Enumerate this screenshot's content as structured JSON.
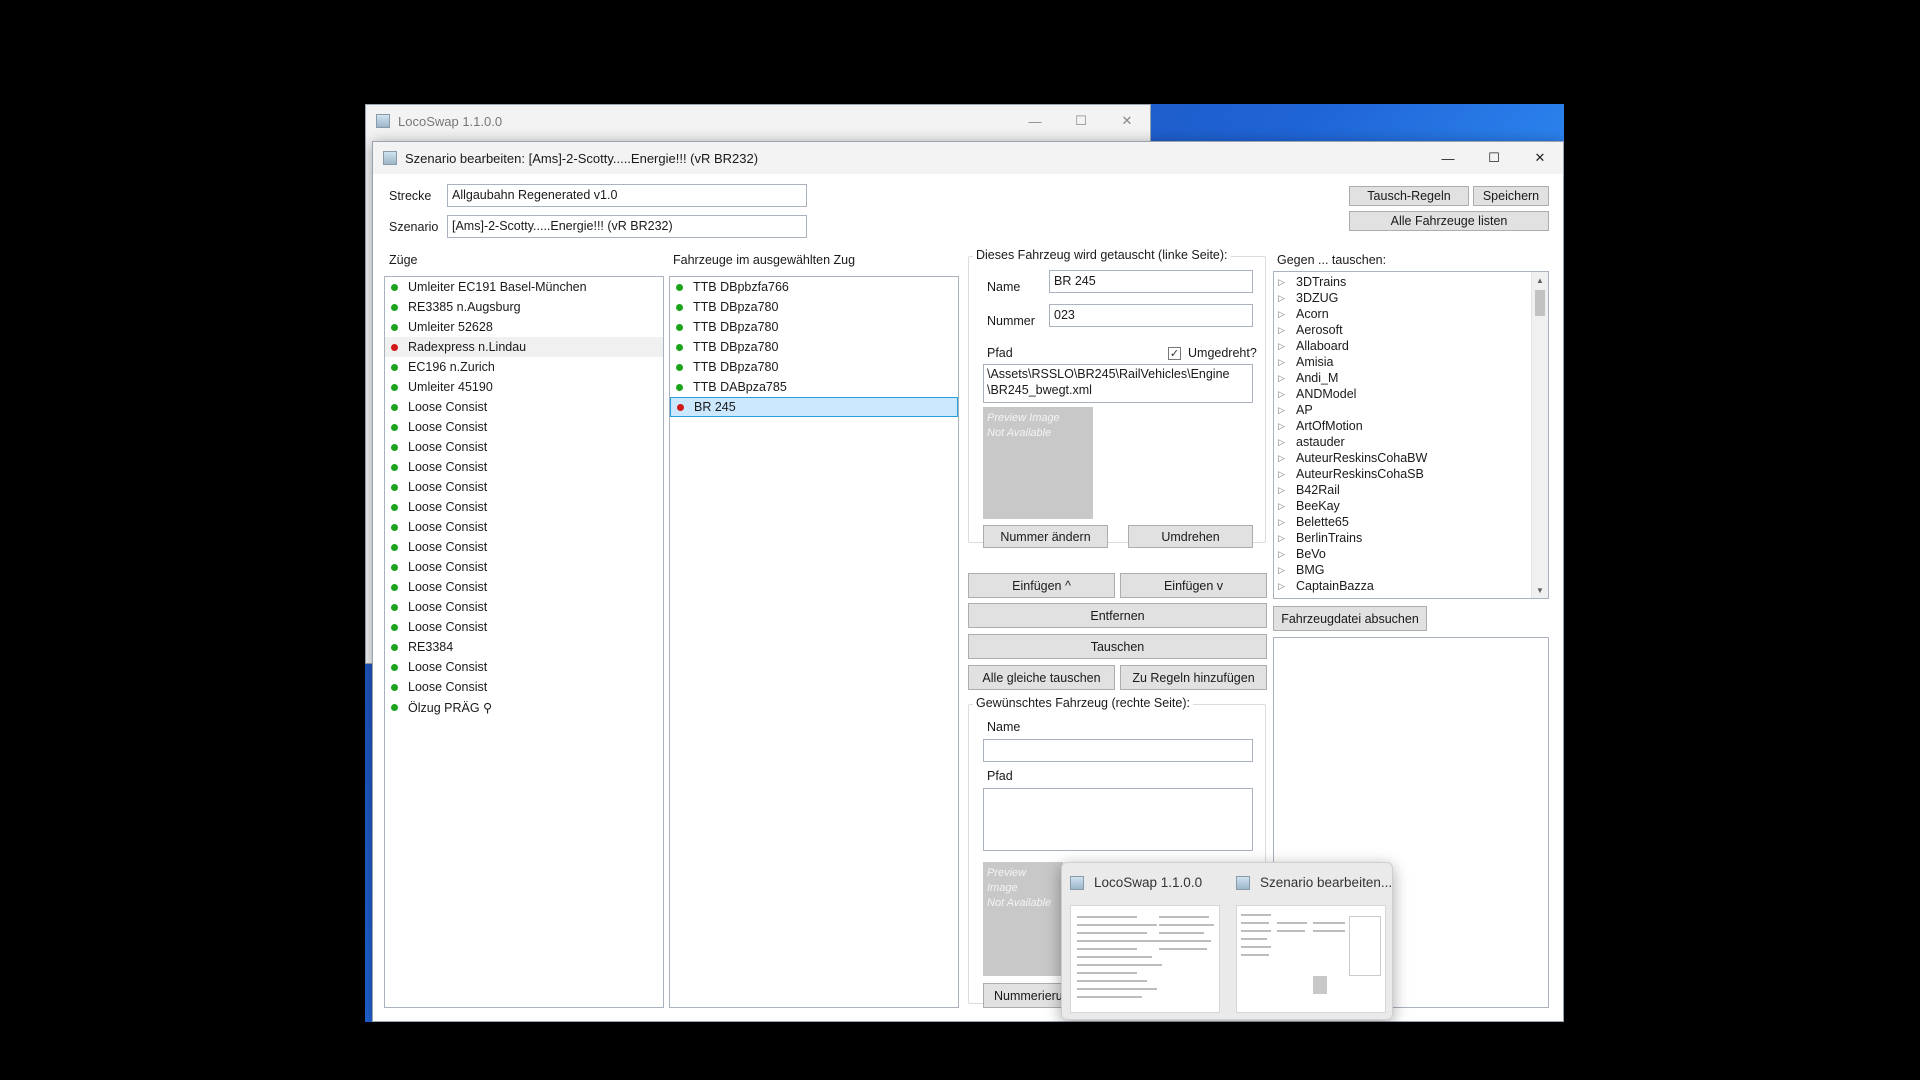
{
  "back_window": {
    "title": "LocoSwap 1.1.0.0"
  },
  "window": {
    "title": "Szenario bearbeiten: [Ams]-2-Scotty.....Energie!!! (vR BR232)",
    "minimize": "—",
    "maximize": "☐",
    "close": "✕"
  },
  "header": {
    "strecke_label": "Strecke",
    "strecke_value": "Allgaubahn Regenerated v1.0",
    "szenario_label": "Szenario",
    "szenario_value": "[Ams]-2-Scotty.....Energie!!! (vR BR232)",
    "tausch_regeln": "Tausch-Regeln",
    "speichern": "Speichern",
    "alle_fahrzeuge": "Alle Fahrzeuge listen"
  },
  "trains": {
    "label": "Züge",
    "items": [
      {
        "name": "Umleiter EC191 Basel-München",
        "status": "green"
      },
      {
        "name": "RE3385 n.Augsburg",
        "status": "green"
      },
      {
        "name": "Umleiter 52628",
        "status": "green"
      },
      {
        "name": "Radexpress n.Lindau",
        "status": "red"
      },
      {
        "name": "EC196 n.Zurich",
        "status": "green"
      },
      {
        "name": "Umleiter 45190",
        "status": "green"
      },
      {
        "name": "Loose Consist",
        "status": "green"
      },
      {
        "name": "Loose Consist",
        "status": "green"
      },
      {
        "name": "Loose Consist",
        "status": "green"
      },
      {
        "name": "Loose Consist",
        "status": "green"
      },
      {
        "name": "Loose Consist",
        "status": "green"
      },
      {
        "name": "Loose Consist",
        "status": "green"
      },
      {
        "name": "Loose Consist",
        "status": "green"
      },
      {
        "name": "Loose Consist",
        "status": "green"
      },
      {
        "name": "Loose Consist",
        "status": "green"
      },
      {
        "name": "Loose Consist",
        "status": "green"
      },
      {
        "name": "Loose Consist",
        "status": "green"
      },
      {
        "name": "Loose Consist",
        "status": "green"
      },
      {
        "name": "RE3384",
        "status": "green"
      },
      {
        "name": "Loose Consist",
        "status": "green"
      },
      {
        "name": "Loose Consist",
        "status": "green"
      },
      {
        "name": "Ölzug PRÄG ⚲",
        "status": "green"
      }
    ]
  },
  "vehicles": {
    "label": "Fahrzeuge im ausgewählten Zug",
    "items": [
      {
        "name": "TTB DBpbzfa766",
        "status": "green"
      },
      {
        "name": "TTB DBpza780",
        "status": "green"
      },
      {
        "name": "TTB DBpza780",
        "status": "green"
      },
      {
        "name": "TTB DBpza780",
        "status": "green"
      },
      {
        "name": "TTB DBpza780",
        "status": "green"
      },
      {
        "name": "TTB DABpza785",
        "status": "green"
      },
      {
        "name": "BR 245",
        "status": "red"
      }
    ]
  },
  "swap_vehicle": {
    "group_title": "Dieses Fahrzeug wird getauscht (linke Seite):",
    "name_label": "Name",
    "name_value": "BR 245",
    "nummer_label": "Nummer",
    "nummer_value": "023",
    "pfad_label": "Pfad",
    "umgedreht_label": "Umgedreht?",
    "umgedreht_checked": "✓",
    "pfad_line1": "\\Assets\\RSSLO\\BR245\\RailVehicles\\Engine",
    "pfad_line2": "\\BR245_bwegt.xml",
    "preview_line1": "Preview Image",
    "preview_line2": "Not Available",
    "nummer_aendern": "Nummer ändern",
    "umdrehen": "Umdrehen"
  },
  "actions": {
    "einfuegen_up": "Einfügen ^",
    "einfuegen_down": "Einfügen v",
    "entfernen": "Entfernen",
    "tauschen": "Tauschen",
    "alle_gleiche": "Alle gleiche tauschen",
    "zu_regeln": "Zu Regeln hinzufügen"
  },
  "target_vehicle": {
    "group_title": "Gewünschtes Fahrzeug (rechte Seite):",
    "name_label": "Name",
    "pfad_label": "Pfad",
    "preview_line1": "Preview Image",
    "preview_line2": "Not Available",
    "nummerierung_btn": "Nummerieru"
  },
  "swap_with": {
    "label": "Gegen ... tauschen:",
    "items": [
      "3DTrains",
      "3DZUG",
      "Acorn",
      "Aerosoft",
      "Allaboard",
      "Amisia",
      "Andi_M",
      "ANDModel",
      "AP",
      "ArtOfMotion",
      "astauder",
      "AuteurReskinsCohaBW",
      "AuteurReskinsCohaSB",
      "B42Rail",
      "BeeKay",
      "Belette65",
      "BerlinTrains",
      "BeVo",
      "BMG",
      "CaptainBazza"
    ],
    "search_button": "Fahrzeugdatei absuchen"
  },
  "taskbar_preview": {
    "items": [
      {
        "title": "LocoSwap 1.1.0.0"
      },
      {
        "title": "Szenario bearbeiten..."
      }
    ]
  }
}
